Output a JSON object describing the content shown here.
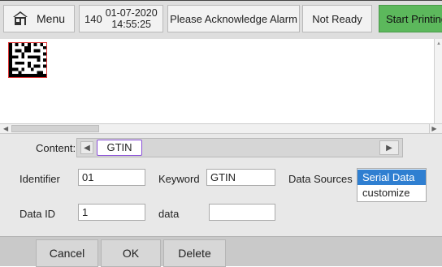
{
  "topbar": {
    "menu_label": "Menu",
    "counter": "140",
    "date": "01-07-2020",
    "time": "14:55:25",
    "alarm": "Please Acknowledge Alarm",
    "status": "Not Ready",
    "start_label": "Start Printing"
  },
  "form": {
    "content_label": "Content:",
    "content_value": "GTIN",
    "identifier_label": "Identifier",
    "identifier_value": "01",
    "keyword_label": "Keyword",
    "keyword_value": "GTIN",
    "data_sources_label": "Data Sources",
    "data_sources": [
      "Serial Data",
      "customize"
    ],
    "data_id_label": "Data ID",
    "data_id_value": "1",
    "data_label": "data",
    "data_value": ""
  },
  "footer": {
    "cancel_label": "Cancel",
    "ok_label": "OK",
    "delete_label": "Delete"
  },
  "colors": {
    "start_button": "#5cb85c",
    "selected_item": "#2f7fd1",
    "chip_border": "#8a4fd8",
    "barcode_border": "#dd3333"
  }
}
